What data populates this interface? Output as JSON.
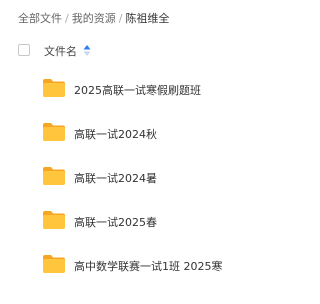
{
  "breadcrumb": {
    "items": [
      "全部文件",
      "我的资源",
      "陈祖维全"
    ],
    "separator": "/"
  },
  "list_header": {
    "column_name": "文件名",
    "sort_icon": "sort-arrows-icon"
  },
  "files": [
    {
      "name": "2025高联一试寒假刷题班",
      "icon": "folder-icon"
    },
    {
      "name": "高联一试2024秋",
      "icon": "folder-icon"
    },
    {
      "name": "高联一试2024暑",
      "icon": "folder-icon"
    },
    {
      "name": "高联一试2025春",
      "icon": "folder-icon"
    },
    {
      "name": "高中数学联赛一试1班 2025寒",
      "icon": "folder-icon"
    }
  ],
  "colors": {
    "folder": "#FFC53D",
    "folder_dark": "#F5A623",
    "sort_active": "#2B7CF6",
    "sort_inactive": "#C9D7EE"
  }
}
